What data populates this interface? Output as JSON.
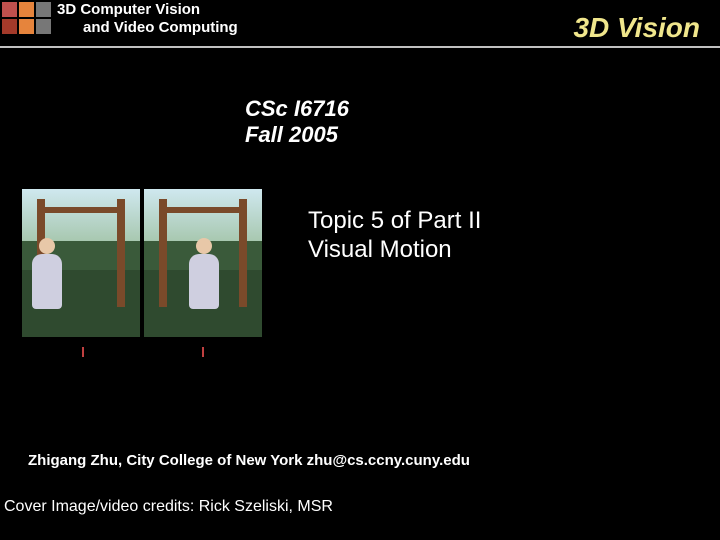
{
  "header": {
    "line1": "3D Computer Vision",
    "line2": "and Video Computing",
    "brand": "3D Vision"
  },
  "course": {
    "code": "CSc I6716",
    "term": "Fall 2005"
  },
  "topic": {
    "line1": "Topic 5 of Part II",
    "line2": "Visual Motion"
  },
  "author": "Zhigang Zhu, City College of New York  zhu@cs.ccny.cuny.edu",
  "credits": "Cover Image/video credits: Rick Szeliski, MSR",
  "logo_colors": {
    "a": "#c0504d",
    "b": "#e6843c",
    "c": "#777777",
    "d": "#a43a2a",
    "e": "#e6843c",
    "f": "#777777"
  }
}
